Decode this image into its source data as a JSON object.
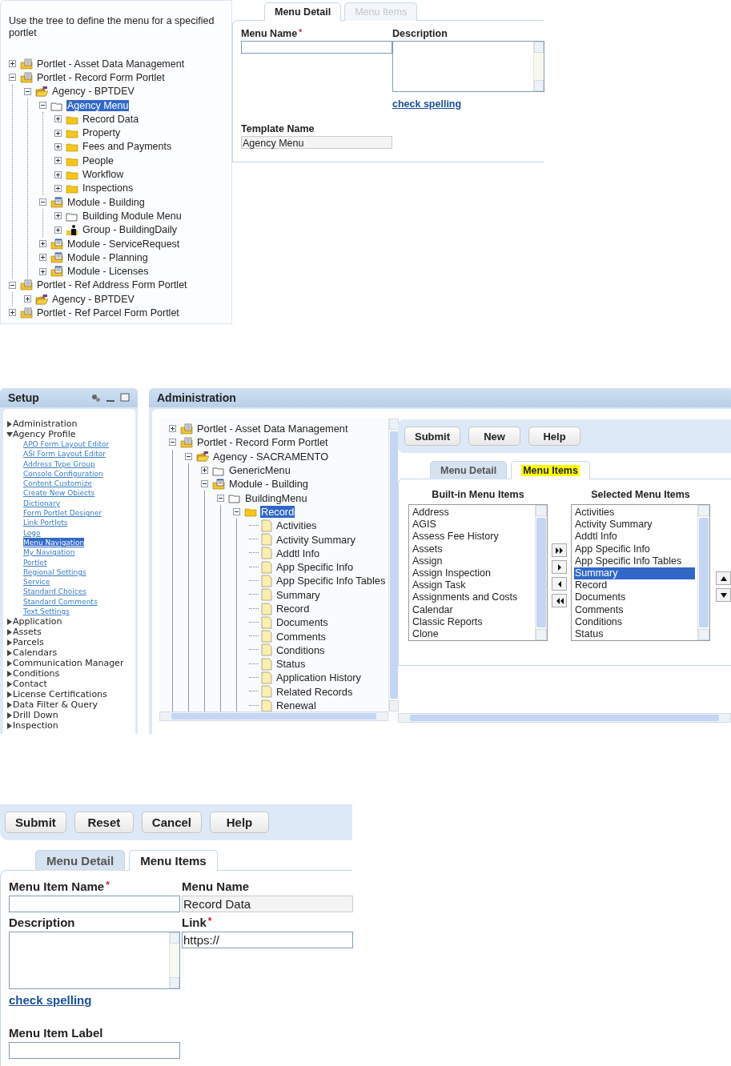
{
  "menu_detail_view": {
    "instruction": "Use the tree to define the menu for a specified portlet",
    "tree": [
      {
        "kind": "portlet",
        "label": "Portlet - Asset Data Management",
        "expanded": false,
        "selected": false
      },
      {
        "kind": "portlet",
        "label": "Portlet - Record Form Portlet",
        "expanded": true,
        "selected": false,
        "children": [
          {
            "kind": "agency",
            "label": "Agency - BPTDEV",
            "expanded": true,
            "selected": false,
            "children": [
              {
                "kind": "menu",
                "label": "Agency Menu",
                "expanded": true,
                "selected": true,
                "children": [
                  {
                    "kind": "folder",
                    "label": "Record Data",
                    "expanded": false,
                    "selected": false
                  },
                  {
                    "kind": "folder",
                    "label": "Property",
                    "expanded": false,
                    "selected": false
                  },
                  {
                    "kind": "folder",
                    "label": "Fees and Payments",
                    "expanded": false,
                    "selected": false
                  },
                  {
                    "kind": "folder",
                    "label": "People",
                    "expanded": false,
                    "selected": false
                  },
                  {
                    "kind": "folder",
                    "label": "Workflow",
                    "expanded": false,
                    "selected": false
                  },
                  {
                    "kind": "folder",
                    "label": "Inspections",
                    "expanded": false,
                    "selected": false
                  }
                ]
              },
              {
                "kind": "module",
                "label": "Module - Building",
                "expanded": true,
                "selected": false,
                "children": [
                  {
                    "kind": "menu",
                    "label": "Building Module Menu",
                    "expanded": false,
                    "selected": false
                  },
                  {
                    "kind": "group",
                    "label": "Group - BuildingDaily",
                    "expanded": false,
                    "selected": false
                  }
                ]
              },
              {
                "kind": "module",
                "label": "Module - ServiceRequest",
                "expanded": false,
                "selected": false
              },
              {
                "kind": "module",
                "label": "Module - Planning",
                "expanded": false,
                "selected": false
              },
              {
                "kind": "module",
                "label": "Module - Licenses",
                "expanded": false,
                "selected": false
              }
            ]
          }
        ]
      },
      {
        "kind": "portlet",
        "label": "Portlet - Ref Address Form Portlet",
        "expanded": true,
        "selected": false,
        "children": [
          {
            "kind": "agency",
            "label": "Agency - BPTDEV",
            "expanded": false,
            "selected": false
          }
        ]
      },
      {
        "kind": "portlet",
        "label": "Portlet - Ref Parcel Form Portlet",
        "expanded": false,
        "selected": false
      }
    ],
    "tabs": [
      {
        "label": "Menu Detail",
        "selected": true,
        "disabled": false
      },
      {
        "label": "Menu Items",
        "selected": false,
        "disabled": true
      }
    ],
    "form": {
      "menu_name_label": "Menu Name",
      "required_mark": "*",
      "description_label": "Description",
      "check_spelling": "check spelling",
      "template_name_label": "Template Name",
      "template_name_value": "Agency Menu"
    }
  },
  "administration_view": {
    "setup_panel": {
      "title": "Setup",
      "items": [
        {
          "label": "Administration",
          "expanded": false
        },
        {
          "label": "Agency Profile",
          "expanded": true,
          "children": [
            {
              "label": "APO Form Layout Editor",
              "selected": false
            },
            {
              "label": "ASI Form Layout Editor",
              "selected": false
            },
            {
              "label": "Address Type Group",
              "selected": false
            },
            {
              "label": "Console Configuration",
              "selected": false
            },
            {
              "label": "Content Customize",
              "selected": false
            },
            {
              "label": "Create New Objects",
              "selected": false
            },
            {
              "label": "Dictionary",
              "selected": false
            },
            {
              "label": "Form Portlet Designer",
              "selected": false
            },
            {
              "label": "Link Portlets",
              "selected": false
            },
            {
              "label": "Logo",
              "selected": false
            },
            {
              "label": "Menu Navigation",
              "selected": true
            },
            {
              "label": "My Navigation",
              "selected": false
            },
            {
              "label": "Portlet",
              "selected": false
            },
            {
              "label": "Regional Settings",
              "selected": false
            },
            {
              "label": "Service",
              "selected": false
            },
            {
              "label": "Standard Choices",
              "selected": false
            },
            {
              "label": "Standard Comments",
              "selected": false
            },
            {
              "label": "Text Settings",
              "selected": false
            }
          ]
        },
        {
          "label": "Application",
          "expanded": false
        },
        {
          "label": "Assets",
          "expanded": false
        },
        {
          "label": "Parcels",
          "expanded": false
        },
        {
          "label": "Calendars",
          "expanded": false
        },
        {
          "label": "Communication Manager",
          "expanded": false
        },
        {
          "label": "Conditions",
          "expanded": false
        },
        {
          "label": "Contact",
          "expanded": false
        },
        {
          "label": "License Certifications",
          "expanded": false
        },
        {
          "label": "Data Filter & Query",
          "expanded": false
        },
        {
          "label": "Drill Down",
          "expanded": false
        },
        {
          "label": "Inspection",
          "expanded": false
        }
      ]
    },
    "title": "Administration",
    "tree": [
      {
        "kind": "portlet",
        "label": "Portlet - Asset Data Management",
        "expanded": false,
        "selected": false
      },
      {
        "kind": "portlet",
        "label": "Portlet - Record Form Portlet",
        "expanded": true,
        "selected": false,
        "children": [
          {
            "kind": "agency",
            "label": "Agency - SACRAMENTO",
            "expanded": true,
            "selected": false,
            "children": [
              {
                "kind": "menu",
                "label": "GenericMenu",
                "expanded": false,
                "selected": false
              },
              {
                "kind": "module",
                "label": "Module - Building",
                "expanded": true,
                "selected": false,
                "children": [
                  {
                    "kind": "menu",
                    "label": "BuildingMenu",
                    "expanded": true,
                    "selected": false,
                    "children": [
                      {
                        "kind": "folder",
                        "label": "Record",
                        "expanded": true,
                        "selected": true,
                        "children": [
                          {
                            "kind": "page",
                            "label": "Activities",
                            "selected": false
                          },
                          {
                            "kind": "page",
                            "label": "Activity Summary",
                            "selected": false
                          },
                          {
                            "kind": "page",
                            "label": "Addtl Info",
                            "selected": false
                          },
                          {
                            "kind": "page",
                            "label": "App Specific Info",
                            "selected": false
                          },
                          {
                            "kind": "page",
                            "label": "App Specific Info Tables",
                            "selected": false
                          },
                          {
                            "kind": "page",
                            "label": "Summary",
                            "selected": false
                          },
                          {
                            "kind": "page",
                            "label": "Record",
                            "selected": false
                          },
                          {
                            "kind": "page",
                            "label": "Documents",
                            "selected": false
                          },
                          {
                            "kind": "page",
                            "label": "Comments",
                            "selected": false
                          },
                          {
                            "kind": "page",
                            "label": "Conditions",
                            "selected": false
                          },
                          {
                            "kind": "page",
                            "label": "Status",
                            "selected": false
                          },
                          {
                            "kind": "page",
                            "label": "Application History",
                            "selected": false
                          },
                          {
                            "kind": "page",
                            "label": "Related Records",
                            "selected": false
                          },
                          {
                            "kind": "page",
                            "label": "Renewal",
                            "selected": false
                          }
                        ]
                      }
                    ]
                  }
                ]
              }
            ]
          }
        ]
      }
    ],
    "buttons": [
      "Submit",
      "New",
      "Help"
    ],
    "tabs": [
      {
        "label": "Menu Detail",
        "selected": false,
        "highlighted": false
      },
      {
        "label": "Menu Items",
        "selected": true,
        "highlighted": true
      }
    ],
    "builtin_list": {
      "title": "Built-in Menu Items",
      "items": [
        {
          "label": "Address",
          "selected": false
        },
        {
          "label": "AGIS",
          "selected": false
        },
        {
          "label": "Assess Fee History",
          "selected": false
        },
        {
          "label": "Assets",
          "selected": false
        },
        {
          "label": "Assign",
          "selected": false
        },
        {
          "label": "Assign Inspection",
          "selected": false
        },
        {
          "label": "Assign Task",
          "selected": false
        },
        {
          "label": "Assignments and Costs",
          "selected": false
        },
        {
          "label": "Calendar",
          "selected": false
        },
        {
          "label": "Classic Reports",
          "selected": false
        },
        {
          "label": "Clone",
          "selected": false
        }
      ]
    },
    "selected_list": {
      "title": "Selected Menu Items",
      "items": [
        {
          "label": "Activities",
          "selected": false
        },
        {
          "label": "Activity Summary",
          "selected": false
        },
        {
          "label": "Addtl Info",
          "selected": false
        },
        {
          "label": "App Specific Info",
          "selected": false
        },
        {
          "label": "App Specific Info Tables",
          "selected": false
        },
        {
          "label": "Summary",
          "selected": true
        },
        {
          "label": "Record",
          "selected": false
        },
        {
          "label": "Documents",
          "selected": false
        },
        {
          "label": "Comments",
          "selected": false
        },
        {
          "label": "Conditions",
          "selected": false
        },
        {
          "label": "Status",
          "selected": false
        }
      ]
    }
  },
  "menu_item_view": {
    "buttons": [
      "Submit",
      "Reset",
      "Cancel",
      "Help"
    ],
    "tabs": [
      {
        "label": "Menu Detail",
        "selected": false
      },
      {
        "label": "Menu Items",
        "selected": true
      }
    ],
    "form": {
      "menu_item_name_label": "Menu Item Name",
      "required_mark": "*",
      "menu_name_label": "Menu Name",
      "menu_name_value": "Record Data",
      "description_label": "Description",
      "link_label": "Link",
      "link_required_mark": "*",
      "link_value": "https://",
      "check_spelling": "check spelling",
      "menu_item_label_label": "Menu Item Label"
    }
  }
}
